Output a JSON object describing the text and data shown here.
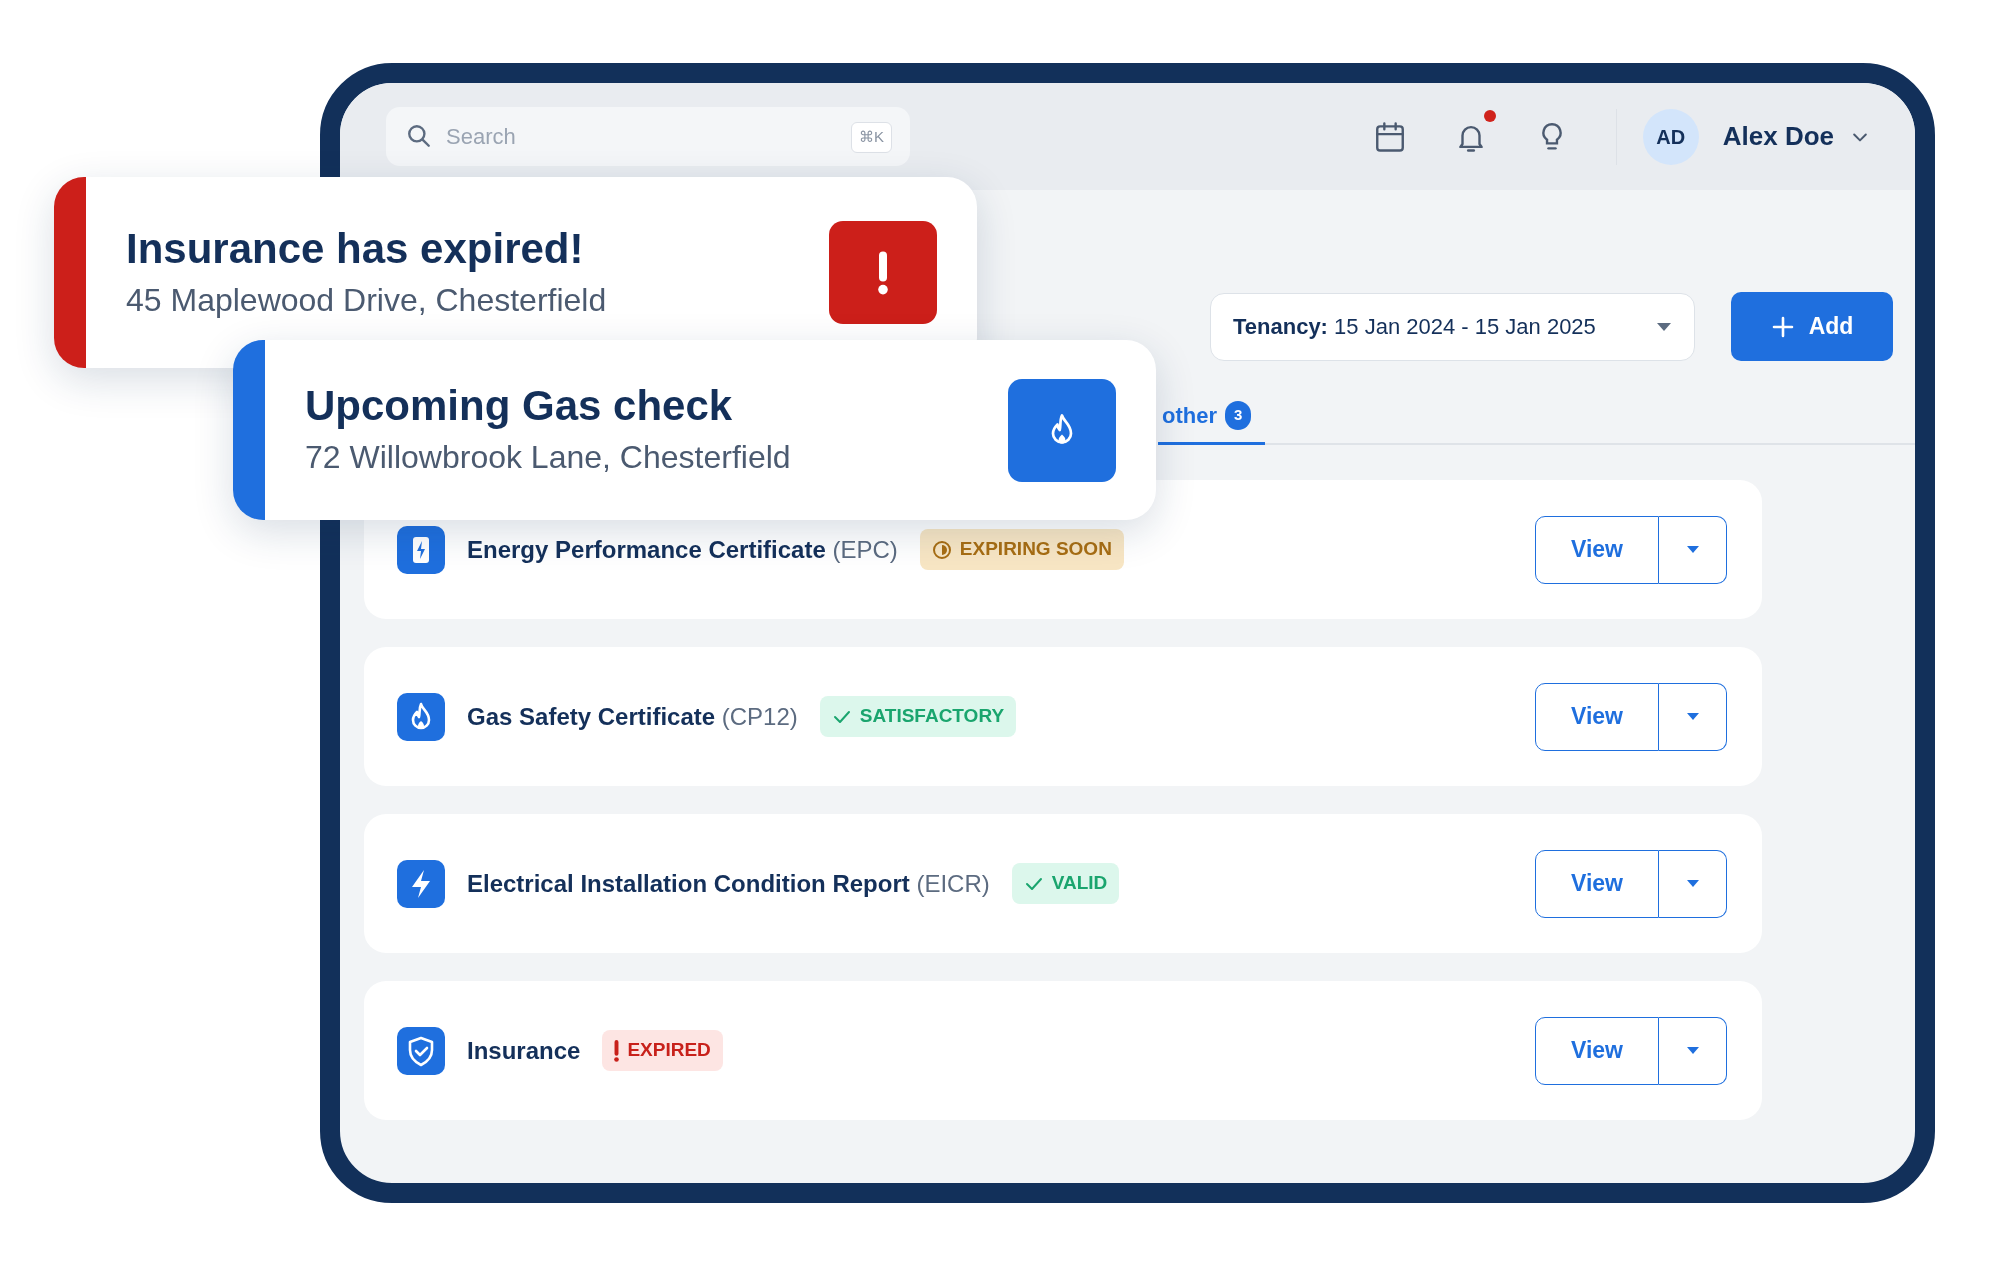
{
  "search": {
    "placeholder": "Search",
    "shortcut": "⌘K"
  },
  "toolbar": {
    "bell_unread": true
  },
  "user": {
    "initials": "AD",
    "name": "Alex Doe"
  },
  "tenancy": {
    "label": "Tenancy:",
    "value": "15 Jan 2024 - 15 Jan 2025"
  },
  "add_button": {
    "label": "Add"
  },
  "tabs": [
    {
      "label": "other",
      "count": "3",
      "selected": true
    }
  ],
  "documents": [
    {
      "kind": "epc",
      "title": "Energy Performance Certificate",
      "code": "(EPC)",
      "status": {
        "text": "EXPIRING SOON",
        "kind": "warning"
      },
      "button": "View"
    },
    {
      "kind": "gas",
      "title": "Gas Safety Certificate",
      "code": "(CP12)",
      "status": {
        "text": "SATISFACTORY",
        "kind": "success"
      },
      "button": "View"
    },
    {
      "kind": "electric",
      "title": "Electrical Installation Condition Report",
      "code": "(EICR)",
      "status": {
        "text": "VALID",
        "kind": "success"
      },
      "button": "View"
    },
    {
      "kind": "insurance",
      "title": "Insurance",
      "status": {
        "text": "EXPIRED",
        "kind": "danger"
      },
      "button": "View"
    }
  ],
  "alerts": [
    {
      "kind": "expired",
      "title": "Insurance has expired!",
      "address": "45 Maplewood Drive, Chesterfield"
    },
    {
      "kind": "gas_check",
      "title": "Upcoming Gas check",
      "address": "72 Willowbrook Lane, Chesterfield"
    }
  ]
}
